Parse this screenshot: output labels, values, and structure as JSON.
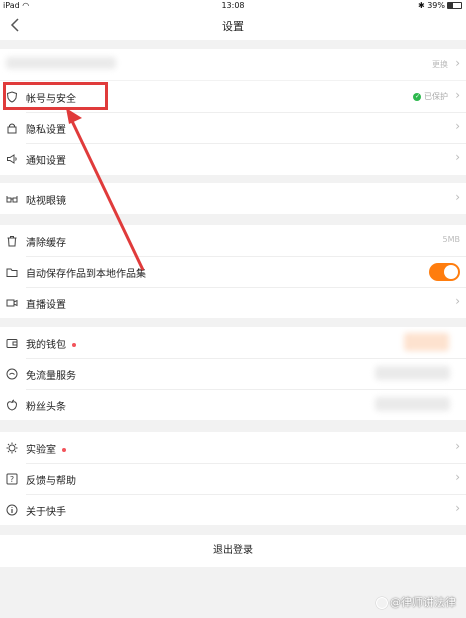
{
  "status_bar": {
    "device": "iPad",
    "time": "13:08",
    "battery": "39%"
  },
  "header": {
    "title": "设置"
  },
  "account_row": {
    "action_label": "更换"
  },
  "group1": [
    {
      "id": "account-security",
      "label": "帐号与安全",
      "value": "已保护",
      "icon": "shield-icon"
    },
    {
      "id": "privacy",
      "label": "隐私设置",
      "icon": "lock-icon"
    },
    {
      "id": "notifications",
      "label": "通知设置",
      "icon": "speaker-icon"
    }
  ],
  "group2": [
    {
      "id": "glasses",
      "label": "哒视眼镜",
      "icon": "glasses-icon"
    }
  ],
  "group3": [
    {
      "id": "clear-cache",
      "label": "清除缓存",
      "value": "5MB",
      "icon": "trash-icon"
    },
    {
      "id": "auto-save",
      "label": "自动保存作品到本地作品集",
      "icon": "folder-icon",
      "toggle": true
    },
    {
      "id": "live",
      "label": "直播设置",
      "icon": "video-camera-icon"
    }
  ],
  "group4": [
    {
      "id": "wallet",
      "label": "我的钱包",
      "icon": "wallet-icon"
    },
    {
      "id": "free-data",
      "label": "免流量服务",
      "icon": "smile-icon"
    },
    {
      "id": "fans-headline",
      "label": "粉丝头条",
      "icon": "apple-icon"
    }
  ],
  "group5": [
    {
      "id": "lab",
      "label": "实验室",
      "icon": "bulb-icon"
    },
    {
      "id": "feedback",
      "label": "反馈与帮助",
      "icon": "help-icon"
    },
    {
      "id": "about",
      "label": "关于快手",
      "icon": "info-icon"
    }
  ],
  "logout": {
    "label": "退出登录"
  },
  "watermark": {
    "text": "@律师讲法律"
  },
  "colors": {
    "accent": "#ff7d0e",
    "highlight": "#e03b3b",
    "protected": "#2db84d"
  }
}
